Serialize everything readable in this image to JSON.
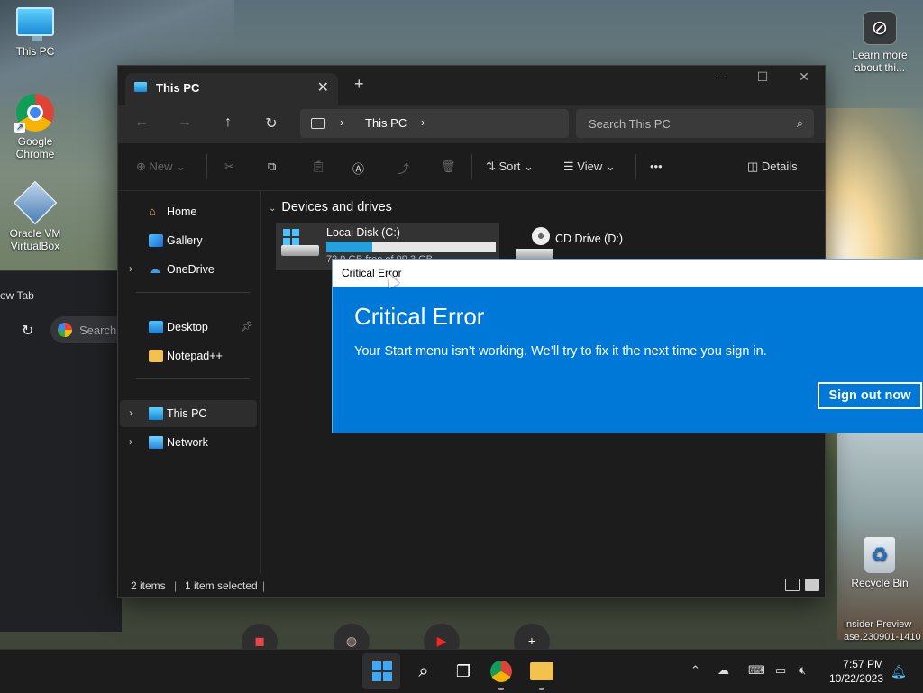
{
  "desktop": {
    "icons": [
      {
        "label": "This PC"
      },
      {
        "label": "Google Chrome"
      },
      {
        "label": "Oracle VM VirtualBox"
      },
      {
        "label": "Learn more about thi..."
      },
      {
        "label": "Recycle Bin"
      }
    ],
    "insider_text": "Insider Preview ase.230901-1410"
  },
  "bg_chrome": {
    "tab_label": "ew Tab",
    "search_placeholder": "Search"
  },
  "explorer": {
    "tab_title": "This PC",
    "address": {
      "crumb": "This PC"
    },
    "search_placeholder": "Search This PC",
    "toolbar": {
      "new_label": "New",
      "sort_label": "Sort",
      "view_label": "View",
      "more_label": "•••",
      "details_label": "Details"
    },
    "nav": [
      {
        "label": "Home"
      },
      {
        "label": "Gallery"
      },
      {
        "label": "OneDrive"
      },
      {
        "label": "Desktop"
      },
      {
        "label": "Notepad++"
      },
      {
        "label": "This PC"
      },
      {
        "label": "Network"
      }
    ],
    "group_header": "Devices and drives",
    "drives": [
      {
        "name": "Local Disk (C:)",
        "free_text": "72.9 GB free of 99.3 GB",
        "used_fraction": 0.27
      },
      {
        "name": "CD Drive (D:)"
      }
    ],
    "status": {
      "items": "2 items",
      "selected": "1 item selected"
    }
  },
  "dialog": {
    "window_title": "Critical Error",
    "heading": "Critical Error",
    "message": "Your Start menu isn’t working. We’ll try to fix it the next time you sign in.",
    "button_label": "Sign out now"
  },
  "taskbar": {
    "time": "7:57 PM",
    "date": "10/22/2023"
  },
  "colors": {
    "accent": "#0078d7",
    "explorer_bg": "#1c1c1c",
    "taskbar_bg": "#1c1c1c"
  }
}
